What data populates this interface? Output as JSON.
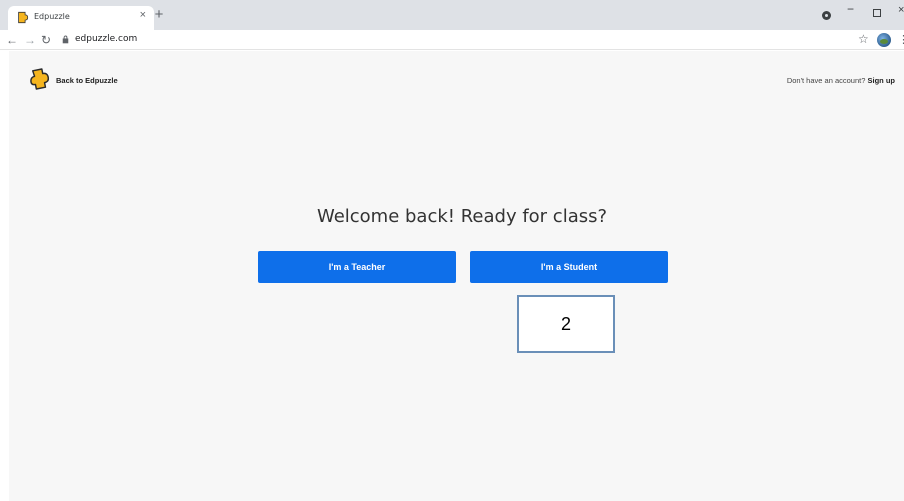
{
  "browser": {
    "tab_title": "Edpuzzle",
    "tab_close": "×",
    "new_tab": "+",
    "url": "edpuzzle.com",
    "window_min": "−",
    "window_close": "×"
  },
  "header": {
    "back_link": "Back to Edpuzzle",
    "signup_prompt": "Don't have an account?",
    "signup_link": "Sign up"
  },
  "main": {
    "headline": "Welcome back! Ready for class?",
    "teacher_button": "I'm a Teacher",
    "student_button": "I'm a Student"
  },
  "annotation": {
    "marker_label": "2"
  },
  "colors": {
    "primary_button": "#0e6fea",
    "page_background": "#f7f7f7",
    "logo_yellow": "#f5b51f"
  }
}
